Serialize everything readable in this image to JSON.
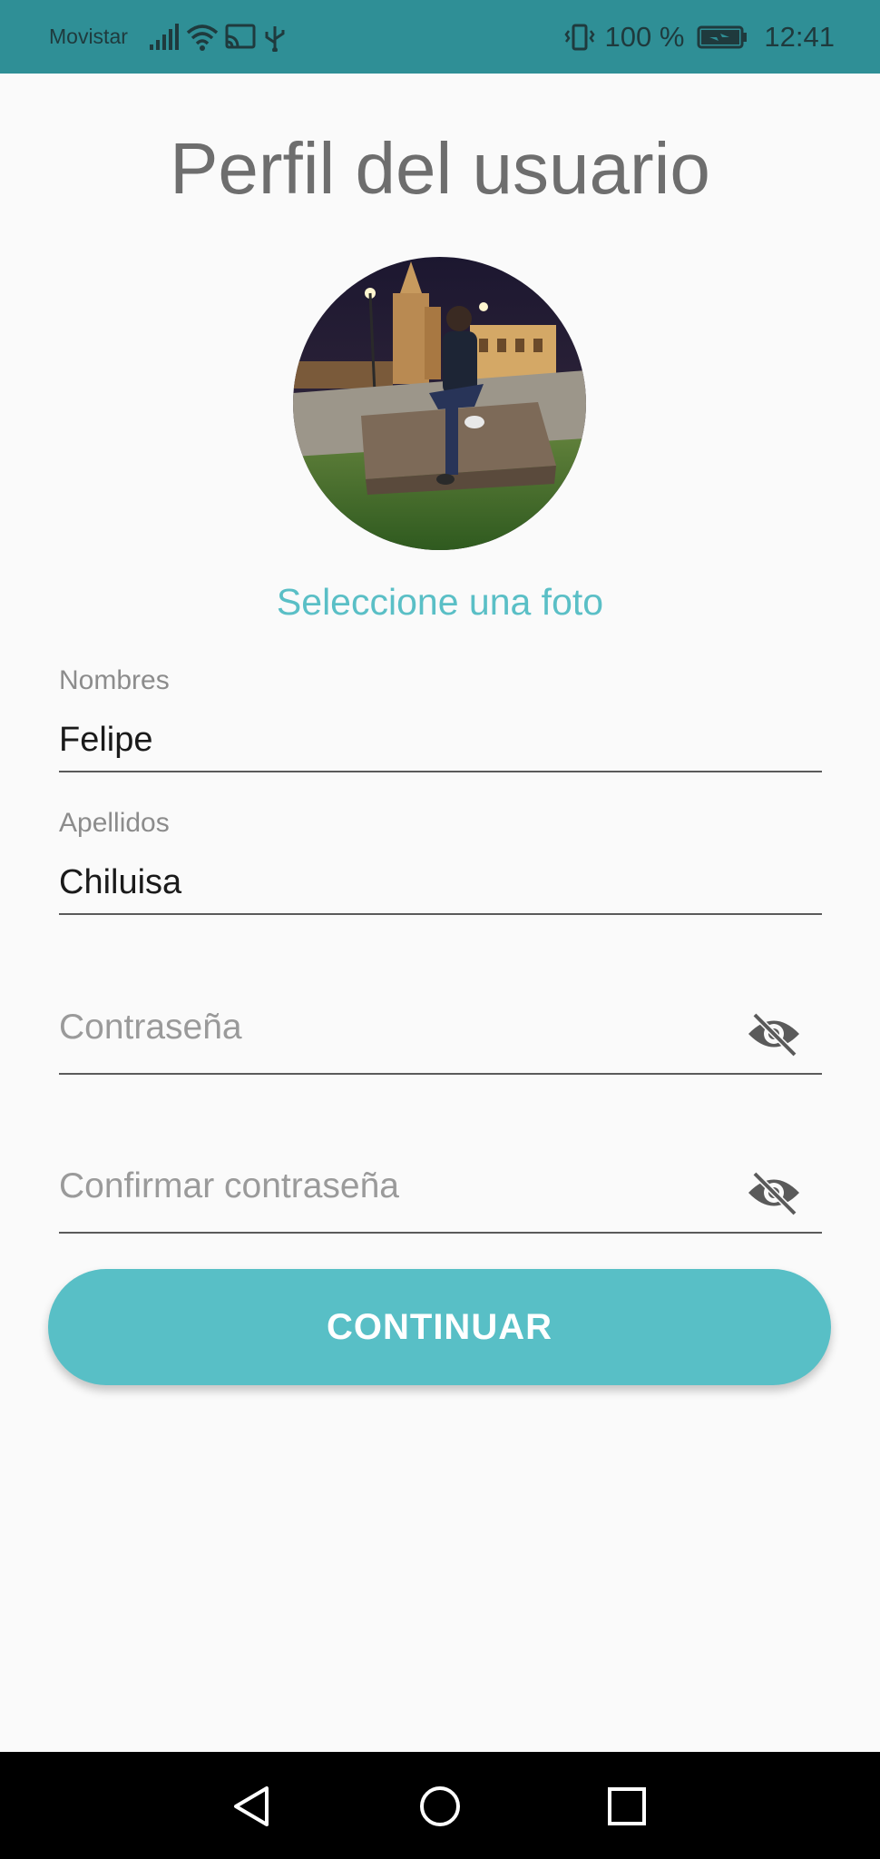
{
  "status_bar": {
    "carrier": "Movistar",
    "battery_percent": "100 %",
    "time": "12:41",
    "icons": [
      "signal-icon",
      "wifi-icon",
      "cast-icon",
      "usb-icon",
      "vibrate-icon",
      "battery-charging-icon"
    ]
  },
  "page": {
    "title": "Perfil del usuario"
  },
  "avatar": {
    "select_photo_label": "Seleccione una foto"
  },
  "form": {
    "first_name": {
      "label": "Nombres",
      "value": "Felipe"
    },
    "last_name": {
      "label": "Apellidos",
      "value": "Chiluisa"
    },
    "password": {
      "placeholder": "Contraseña",
      "toggle_icon": "visibility-off-icon"
    },
    "confirm_password": {
      "placeholder": "Confirmar contraseña",
      "toggle_icon": "visibility-off-icon"
    }
  },
  "actions": {
    "continue_label": "CONTINUAR"
  },
  "nav_bar": {
    "buttons": [
      "back-icon",
      "home-icon",
      "recents-icon"
    ]
  },
  "colors": {
    "status_bar": "#2f8f96",
    "accent": "#5abfc6",
    "button": "#58bfc6",
    "title": "#6e6e6e",
    "background": "#fafafa"
  }
}
